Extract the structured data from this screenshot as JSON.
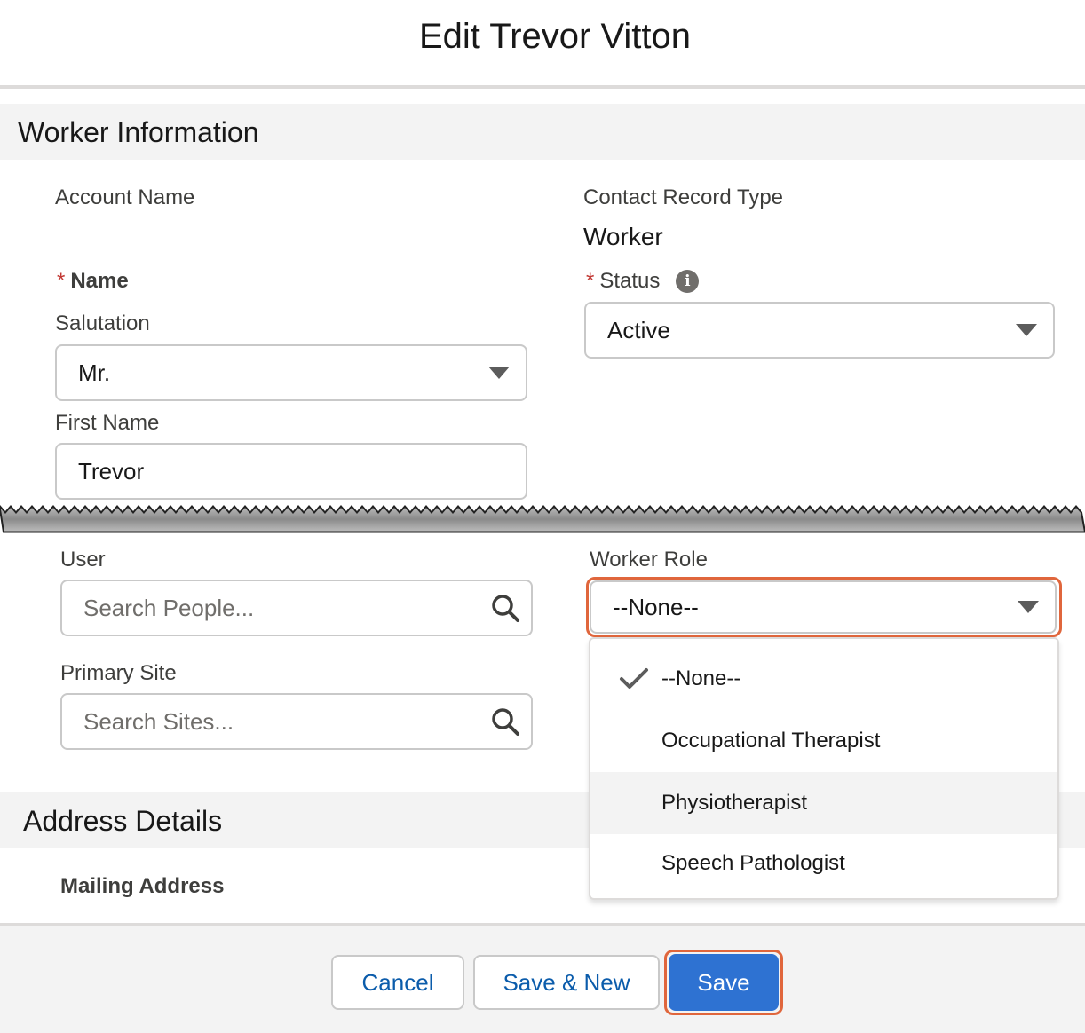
{
  "header": {
    "title": "Edit Trevor Vitton"
  },
  "sections": {
    "worker_information": "Worker Information",
    "address_details": "Address Details"
  },
  "fields": {
    "account_name": {
      "label": "Account Name"
    },
    "contact_record_type": {
      "label": "Contact Record Type",
      "value": "Worker"
    },
    "name": {
      "required_mark": "*",
      "label": "Name"
    },
    "status": {
      "required_mark": "*",
      "label": "Status",
      "value": "Active",
      "info_icon": "info-icon"
    },
    "salutation": {
      "label": "Salutation",
      "value": "Mr."
    },
    "first_name": {
      "label": "First Name",
      "value": "Trevor"
    },
    "user": {
      "label": "User",
      "placeholder": "Search People..."
    },
    "primary_site": {
      "label": "Primary Site",
      "placeholder": "Search Sites..."
    },
    "worker_role": {
      "label": "Worker Role",
      "value": "--None--"
    },
    "mailing_address": {
      "label": "Mailing Address"
    }
  },
  "worker_role_options": [
    {
      "label": "--None--",
      "selected": true
    },
    {
      "label": "Occupational Therapist",
      "selected": false
    },
    {
      "label": "Physiotherapist",
      "selected": false,
      "hovered": true
    },
    {
      "label": "Speech Pathologist",
      "selected": false
    }
  ],
  "footer": {
    "cancel_label": "Cancel",
    "save_new_label": "Save & New",
    "save_label": "Save"
  },
  "colors": {
    "accent_ring": "#e0663c",
    "brand_blue": "#2e72d2",
    "link_blue": "#0b5cab",
    "required_red": "#c23934"
  }
}
